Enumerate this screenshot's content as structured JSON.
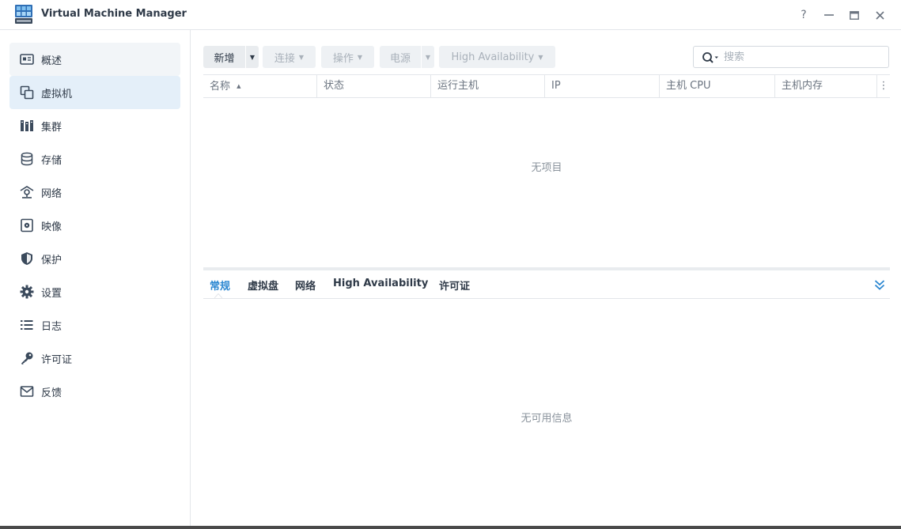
{
  "window": {
    "title": "Virtual Machine Manager",
    "help_glyph": "?",
    "minimize_glyph": "—",
    "close_glyph": "✕"
  },
  "sidebar": {
    "items": [
      {
        "label": "概述",
        "icon": "overview-icon"
      },
      {
        "label": "虚拟机",
        "icon": "virtual-machine-icon",
        "active": true
      },
      {
        "label": "集群",
        "icon": "cluster-icon"
      },
      {
        "label": "存储",
        "icon": "storage-icon"
      },
      {
        "label": "网络",
        "icon": "network-icon"
      },
      {
        "label": "映像",
        "icon": "image-icon"
      },
      {
        "label": "保护",
        "icon": "protection-shield-icon"
      },
      {
        "label": "设置",
        "icon": "gear-icon"
      },
      {
        "label": "日志",
        "icon": "log-list-icon"
      },
      {
        "label": "许可证",
        "icon": "key-icon"
      },
      {
        "label": "反馈",
        "icon": "mail-icon"
      }
    ]
  },
  "toolbar": {
    "create": "新增",
    "connect": "连接",
    "action": "操作",
    "power": "电源",
    "high_availability": "High Availability"
  },
  "search": {
    "placeholder": "搜索"
  },
  "grid": {
    "columns": [
      "名称",
      "状态",
      "运行主机",
      "IP",
      "主机 CPU",
      "主机内存"
    ],
    "sort_glyph": "▲",
    "more_glyph": "⋮",
    "empty_text": "无项目"
  },
  "detail": {
    "tabs": [
      "常规",
      "虚拟盘",
      "网络",
      "High Availability",
      "许可证"
    ],
    "empty_text": "无可用信息"
  },
  "colors": {
    "accent": "#2b87d1",
    "active_nav_bg": "#e4eff9",
    "disabled_text": "#a9b1ba"
  }
}
